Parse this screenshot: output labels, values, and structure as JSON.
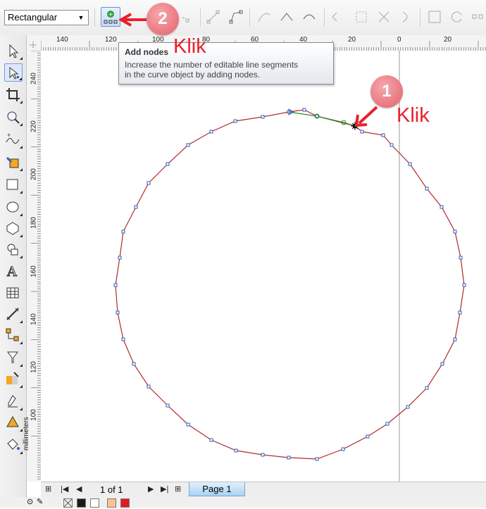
{
  "property_bar": {
    "shape_dropdown_value": "Rectangular",
    "add_nodes_button_icon": "add-nodes-icon"
  },
  "tooltip": {
    "title": "Add nodes",
    "description_line1": "Increase the number of editable line segments",
    "description_line2": "in the curve object by adding nodes."
  },
  "annotations": {
    "step1_number": "1",
    "step1_label": "Klik",
    "step2_number": "2",
    "step2_label": "Klik",
    "accent_color": "#e8212b"
  },
  "ruler": {
    "top_labels": [
      "140",
      "120",
      "100",
      "80",
      "60",
      "40",
      "20",
      "0",
      "20"
    ],
    "left_labels": [
      "240",
      "220",
      "200",
      "180",
      "160",
      "140",
      "120",
      "100"
    ],
    "unit": "millimeters"
  },
  "page_navigator": {
    "page_count": "1 of 1",
    "page_tab": "Page 1"
  },
  "palette": {
    "colors": [
      "#ffffff",
      "#1a1a1a",
      "#ffffff",
      "#f7c58f",
      "#e11b22"
    ]
  },
  "curve": {
    "line_color": "#b22a2a",
    "node_color": "#2f5fbf"
  }
}
